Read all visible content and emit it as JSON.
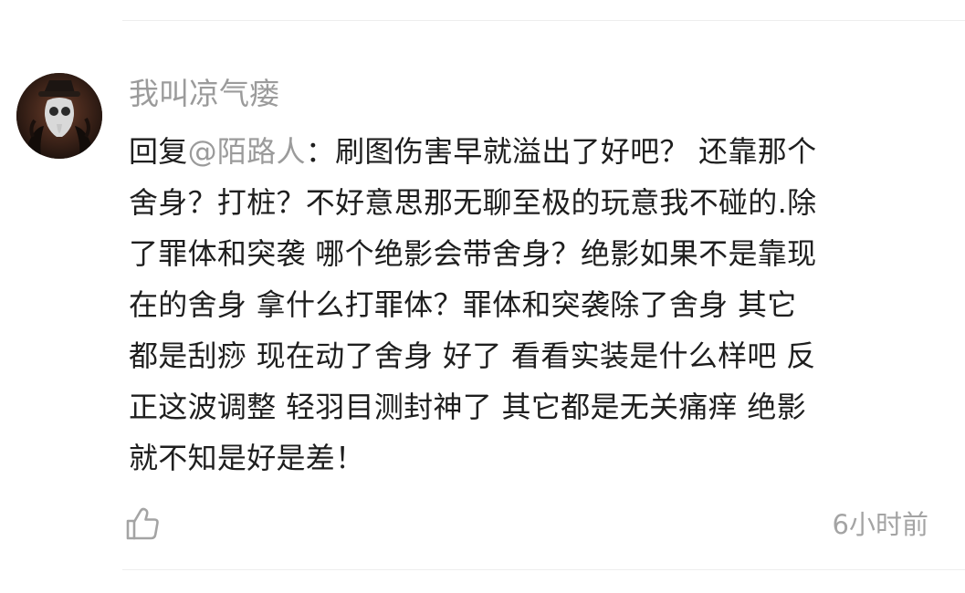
{
  "comment": {
    "author": "我叫凉气瘘",
    "reply_prefix": "回复",
    "mention": "@陌路人",
    "lines": [
      "：刷图伤害早就溢出了好吧？ 还靠那个",
      "舍身？打桩？不好意思那无聊至极的玩意我不碰的.除",
      "了罪体和突袭 哪个绝影会带舍身？绝影如果不是靠现",
      "在的舍身 拿什么打罪体？罪体和突袭除了舍身  其它",
      "都是刮痧 现在动了舍身 好了 看看实装是什么样吧  反",
      "正这波调整 轻羽目测封神了 其它都是无关痛痒 绝影",
      "就不知是好是差！"
    ],
    "timestamp": "6小时前",
    "like_icon": "thumbs-up-icon"
  },
  "colors": {
    "text_primary": "#1e1e1e",
    "text_secondary": "#9b9b9b",
    "divider": "#ededed",
    "icon": "#a4a4a4"
  }
}
